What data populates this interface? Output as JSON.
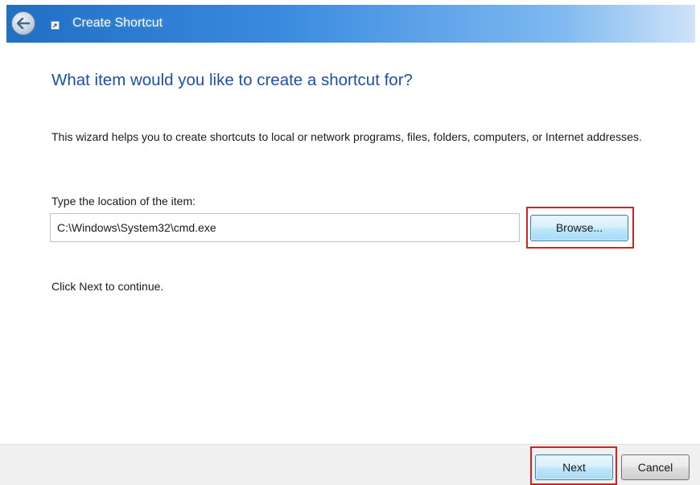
{
  "window": {
    "title": "Create Shortcut"
  },
  "main": {
    "heading": "What item would you like to create a shortcut for?",
    "description": "This wizard helps you to create shortcuts to local or network programs, files, folders, computers, or Internet addresses.",
    "location_label": "Type the location of the item:",
    "location_value": "C:\\Windows\\System32\\cmd.exe",
    "browse_label": "Browse...",
    "continue_hint": "Click Next to continue."
  },
  "footer": {
    "next_label": "Next",
    "cancel_label": "Cancel"
  },
  "icons": {
    "back": "back-arrow-icon",
    "title": "shortcut-icon"
  },
  "colors": {
    "heading": "#1e4fa6",
    "highlight": "#d92020",
    "titlebar": "#3a8be0"
  }
}
